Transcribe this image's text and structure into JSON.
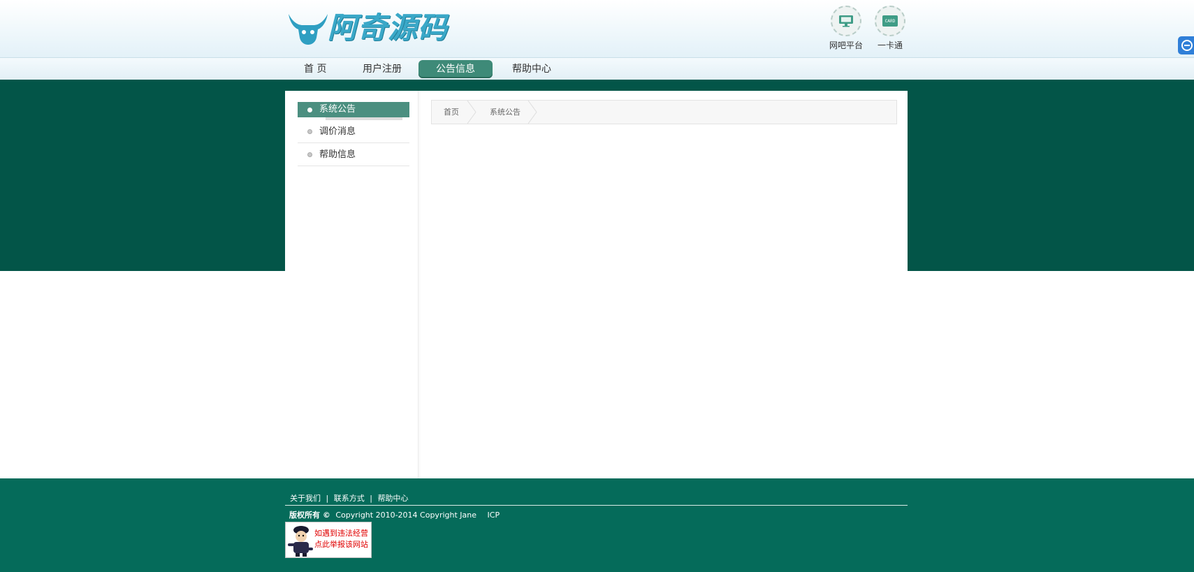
{
  "header": {
    "logo_text": "阿奇源码",
    "top_links": [
      {
        "label": "网吧平台",
        "icon": "monitor-icon"
      },
      {
        "label": "一卡通",
        "icon": "card-icon",
        "icon_text": "CARD"
      }
    ]
  },
  "nav": {
    "items": [
      {
        "label": "首 页"
      },
      {
        "label": "用户注册"
      },
      {
        "label": "公告信息",
        "active": true
      },
      {
        "label": "帮助中心"
      }
    ]
  },
  "sidebar": {
    "items": [
      {
        "label": "系统公告",
        "active": true
      },
      {
        "label": "调价消息"
      },
      {
        "label": "帮助信息"
      }
    ]
  },
  "breadcrumb": {
    "items": [
      "首页",
      "系统公告"
    ]
  },
  "footer": {
    "links": [
      "关于我们",
      "联系方式",
      "帮助中心"
    ],
    "separator": "|",
    "copyright_prefix": "版权所有 ©",
    "copyright_text": "Copyright 2010-2014 Copyright Jane",
    "icp": "ICP",
    "police_badge": {
      "line1": "如遇到违法经营",
      "line2": "点此举报该网站"
    }
  },
  "colors": {
    "band": "#035548",
    "footer": "#056b5a",
    "nav_active": "#3e8a78",
    "sidebar_active": "#4b8f80",
    "logo": "#3aa8c8"
  }
}
